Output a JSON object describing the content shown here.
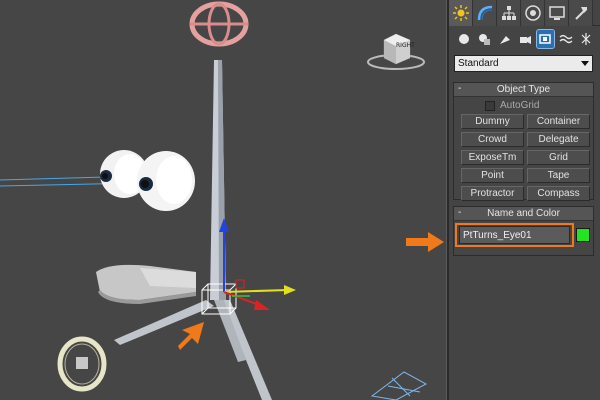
{
  "viewport": {
    "viewcube_label": "RIGHT"
  },
  "command_panel": {
    "tabs": [
      {
        "icon": "create-icon",
        "active": true
      },
      {
        "icon": "modify-icon",
        "active": false
      },
      {
        "icon": "hierarchy-icon",
        "active": false
      },
      {
        "icon": "motion-icon",
        "active": false
      },
      {
        "icon": "display-icon",
        "active": false
      },
      {
        "icon": "utilities-icon",
        "active": false
      }
    ],
    "category_icons": [
      {
        "icon": "geometry-icon",
        "active": false
      },
      {
        "icon": "shapes-icon",
        "active": false
      },
      {
        "icon": "lights-icon",
        "active": false
      },
      {
        "icon": "cameras-icon",
        "active": false
      },
      {
        "icon": "helpers-icon",
        "active": true
      },
      {
        "icon": "space-warps-icon",
        "active": false
      },
      {
        "icon": "systems-icon",
        "active": false
      }
    ],
    "dropdown_value": "Standard",
    "object_type": {
      "title": "Object Type",
      "collapse": "-",
      "autogrid_label": "AutoGrid",
      "buttons": [
        "Dummy",
        "Container",
        "Crowd",
        "Delegate",
        "ExposeTm",
        "Grid",
        "Point",
        "Tape",
        "Protractor",
        "Compass"
      ]
    },
    "name_and_color": {
      "title": "Name and Color",
      "collapse": "-",
      "name_value": "PtTurns_Eye01",
      "color": "#22e522"
    }
  },
  "accent_color": "#f07a1a"
}
